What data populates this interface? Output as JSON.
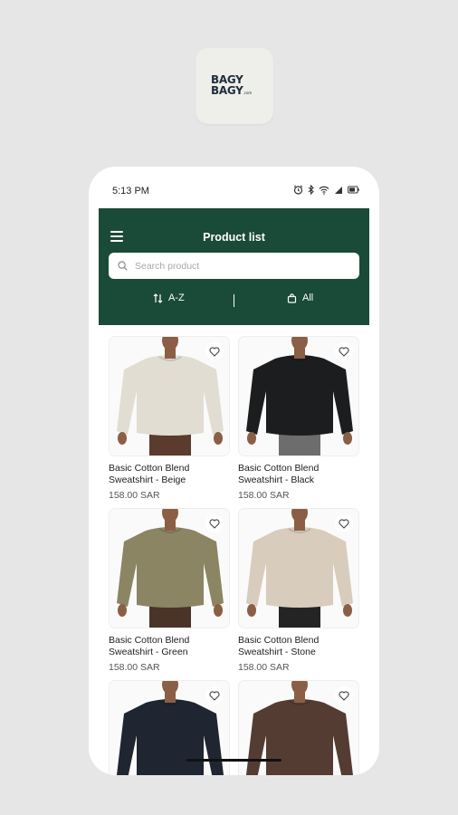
{
  "logo": {
    "line1": "BAGY",
    "line2": "BAGY",
    "suffix": ".com"
  },
  "status_bar": {
    "time": "5:13 PM"
  },
  "header": {
    "title": "Product list",
    "search_placeholder": "Search product",
    "sort_label": "A-Z",
    "category_label": "All"
  },
  "colors": {
    "header_bg": "#1a4a38"
  },
  "products": [
    {
      "name": "Basic Cotton Blend Sweatshirt - Beige",
      "price": "158.00 SAR",
      "sweater_color": "#e2ddd3",
      "pants_color": "#5a3b2e"
    },
    {
      "name": "Basic Cotton Blend Sweatshirt - Black",
      "price": "158.00 SAR",
      "sweater_color": "#1c1d1f",
      "pants_color": "#6d6d6d"
    },
    {
      "name": "Basic Cotton Blend Sweatshirt - Green",
      "price": "158.00 SAR",
      "sweater_color": "#8b8563",
      "pants_color": "#4a3328"
    },
    {
      "name": "Basic Cotton Blend Sweatshirt - Stone",
      "price": "158.00 SAR",
      "sweater_color": "#d8ccbc",
      "pants_color": "#242424"
    },
    {
      "name": "",
      "price": "",
      "sweater_color": "#1f2631",
      "pants_color": "#1f2631"
    },
    {
      "name": "",
      "price": "",
      "sweater_color": "#553c33",
      "pants_color": "#553c33"
    }
  ]
}
